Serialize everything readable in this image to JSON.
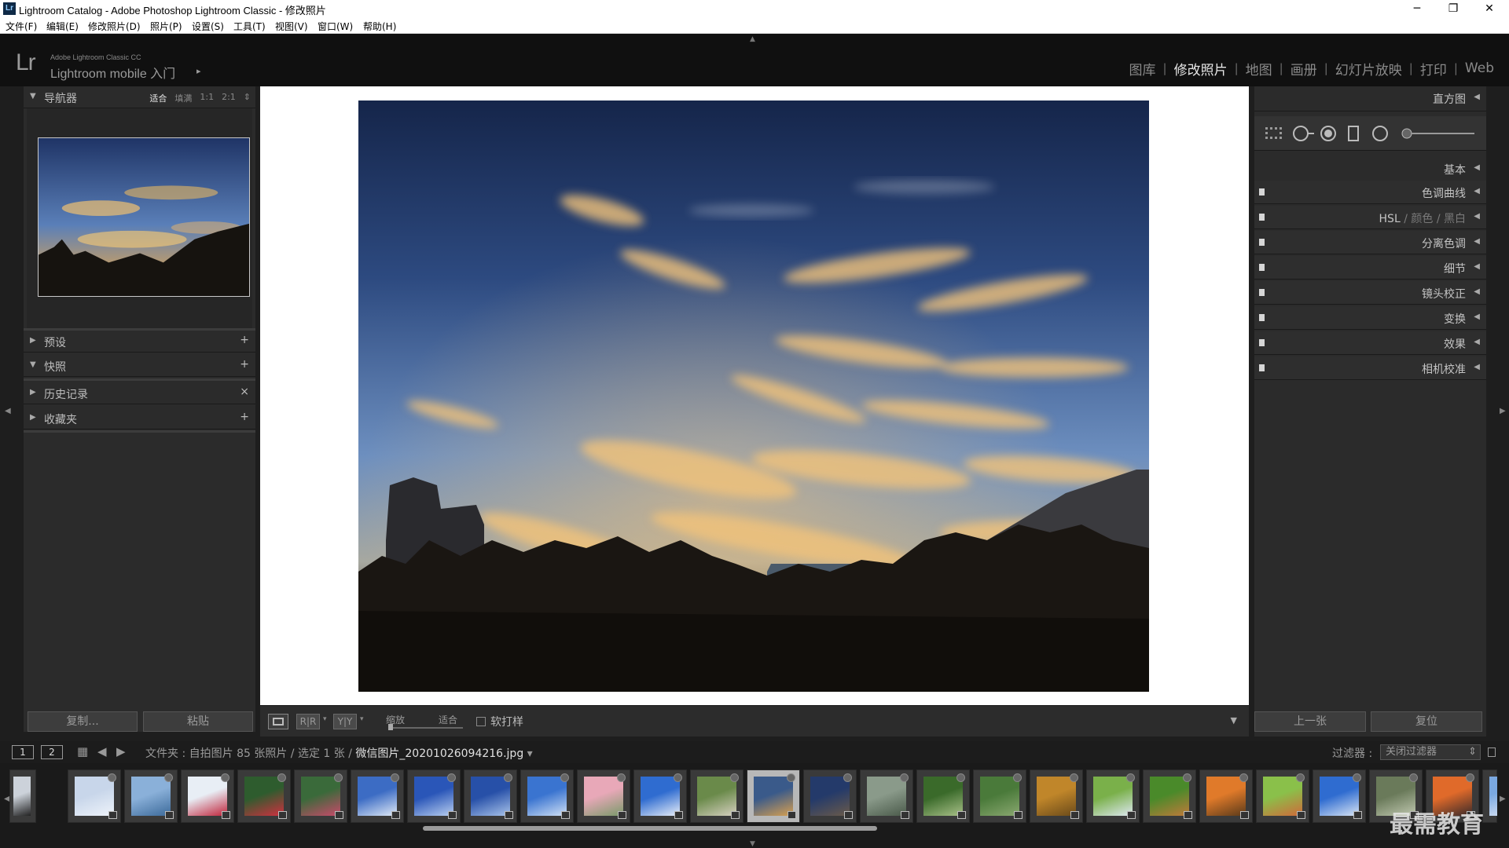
{
  "window": {
    "title": "Lightroom Catalog - Adobe Photoshop Lightroom Classic - 修改照片",
    "app_badge": "Lr",
    "controls": [
      "─",
      "❐",
      "✕"
    ]
  },
  "menu": [
    "文件(F)",
    "编辑(E)",
    "修改照片(D)",
    "照片(P)",
    "设置(S)",
    "工具(T)",
    "视图(V)",
    "窗口(W)",
    "帮助(H)"
  ],
  "identity": {
    "logo": "Lr",
    "product_small": "Adobe Lightroom Classic CC",
    "product_main": "Lightroom mobile 入门",
    "arrow": "▸"
  },
  "modules": [
    {
      "label": "图库",
      "active": false
    },
    {
      "label": "修改照片",
      "active": true
    },
    {
      "label": "地图",
      "active": false
    },
    {
      "label": "画册",
      "active": false
    },
    {
      "label": "幻灯片放映",
      "active": false
    },
    {
      "label": "打印",
      "active": false
    },
    {
      "label": "Web",
      "active": false
    }
  ],
  "left_panel": {
    "navigator": {
      "title": "导航器",
      "zoom_options": [
        "适合",
        "填满",
        "1:1",
        "2:1"
      ],
      "zoom_active": "适合",
      "zoom_menu_icon": "⇕"
    },
    "sections": [
      {
        "label": "预设",
        "expanded": false,
        "action": "+"
      },
      {
        "label": "快照",
        "expanded": true,
        "action": "+"
      },
      {
        "label": "历史记录",
        "expanded": false,
        "action": "×"
      },
      {
        "label": "收藏夹",
        "expanded": false,
        "action": "+"
      }
    ],
    "buttons": {
      "copy": "复制...",
      "paste": "粘贴"
    }
  },
  "toolbar": {
    "view_loupe_icon": "loupe-view-icon",
    "ba_label": "R|R",
    "yy_label": "Y|Y",
    "zoom_label": "缩放",
    "fit_label": "适合",
    "softproof_label": "软打样",
    "softproof_checked": false,
    "expand_icon": "▼"
  },
  "right_panel": {
    "histogram": "直方图",
    "basic": "基本",
    "tone_curve": "色调曲线",
    "hsl": {
      "hsl": "HSL",
      "color": "颜色",
      "bw": "黑白",
      "sep": "/"
    },
    "split_toning": "分离色调",
    "detail": "细节",
    "lens": "镜头校正",
    "transform": "变换",
    "effects": "效果",
    "calibration": "相机校准",
    "buttons": {
      "previous": "上一张",
      "reset": "复位"
    }
  },
  "filmstrip_bar": {
    "page1": "1",
    "page2": "2",
    "breadcrumb": "文件夹 : 自拍图片    85 张照片 / 选定 1 张 /",
    "filename": "微信图片_20201026094216.jpg",
    "dropdown": "▾",
    "filter_label": "过滤器 :",
    "filter_value": "关闭过滤器",
    "filter_arrow": "⇕"
  },
  "filmstrip": {
    "thumbnails": [
      {
        "kind": "partial",
        "colors": [
          "#ccd2da",
          "#222"
        ]
      },
      {
        "kind": "snow",
        "colors": [
          "#c8d6ea",
          "#eef3fa"
        ]
      },
      {
        "kind": "lake",
        "colors": [
          "#8ab0d9",
          "#3c6a9a"
        ]
      },
      {
        "kind": "berries",
        "colors": [
          "#e8eef5",
          "#c0233a"
        ]
      },
      {
        "kind": "flowers-red",
        "colors": [
          "#2e5c2e",
          "#d03040"
        ]
      },
      {
        "kind": "flowers-pink",
        "colors": [
          "#3a6a3a",
          "#c84a6a"
        ]
      },
      {
        "kind": "sky",
        "colors": [
          "#3c6cc4",
          "#dfe9f6"
        ]
      },
      {
        "kind": "sky",
        "colors": [
          "#2a56b8",
          "#b9cff0"
        ]
      },
      {
        "kind": "sky",
        "colors": [
          "#2750a8",
          "#a8c3ea"
        ]
      },
      {
        "kind": "sky-wide",
        "colors": [
          "#3a74d0",
          "#cfe0f5"
        ]
      },
      {
        "kind": "flowers-pink",
        "colors": [
          "#e8a8b8",
          "#7a9a6a"
        ]
      },
      {
        "kind": "sky",
        "colors": [
          "#2f6cd0",
          "#e8eef8"
        ]
      },
      {
        "kind": "trees",
        "colors": [
          "#6a8a4a",
          "#d6d0c0"
        ]
      },
      {
        "kind": "sunset",
        "colors": [
          "#3a5a8a",
          "#d8a050"
        ],
        "selected": true
      },
      {
        "kind": "dusk",
        "colors": [
          "#243a6a",
          "#6a5a4a"
        ]
      },
      {
        "kind": "path",
        "colors": [
          "#8a9a8a",
          "#4a5a4a"
        ]
      },
      {
        "kind": "garden",
        "colors": [
          "#3a6a2a",
          "#a8c088"
        ]
      },
      {
        "kind": "garden",
        "colors": [
          "#4a7a3a",
          "#8aa870"
        ]
      },
      {
        "kind": "autumn",
        "colors": [
          "#c0862a",
          "#6a4a1a"
        ]
      },
      {
        "kind": "leaves",
        "colors": [
          "#7ab04a",
          "#dde8f0"
        ]
      },
      {
        "kind": "plant",
        "colors": [
          "#4a8a2a",
          "#c07a3a"
        ]
      },
      {
        "kind": "orange-leaves",
        "colors": [
          "#e07a2a",
          "#5a3a1a"
        ]
      },
      {
        "kind": "leaf",
        "colors": [
          "#8ac04a",
          "#d06a3a"
        ]
      },
      {
        "kind": "sky",
        "colors": [
          "#2f6cd0",
          "#d8e4f4"
        ]
      },
      {
        "kind": "forest",
        "colors": [
          "#6a7a5a",
          "#c0c8b0"
        ]
      },
      {
        "kind": "sunset-orange",
        "colors": [
          "#e06a2a",
          "#3a2a2a"
        ]
      },
      {
        "kind": "partial",
        "colors": [
          "#7aa8e0",
          "#c8d8f0"
        ]
      }
    ]
  },
  "watermark": "最需教育"
}
